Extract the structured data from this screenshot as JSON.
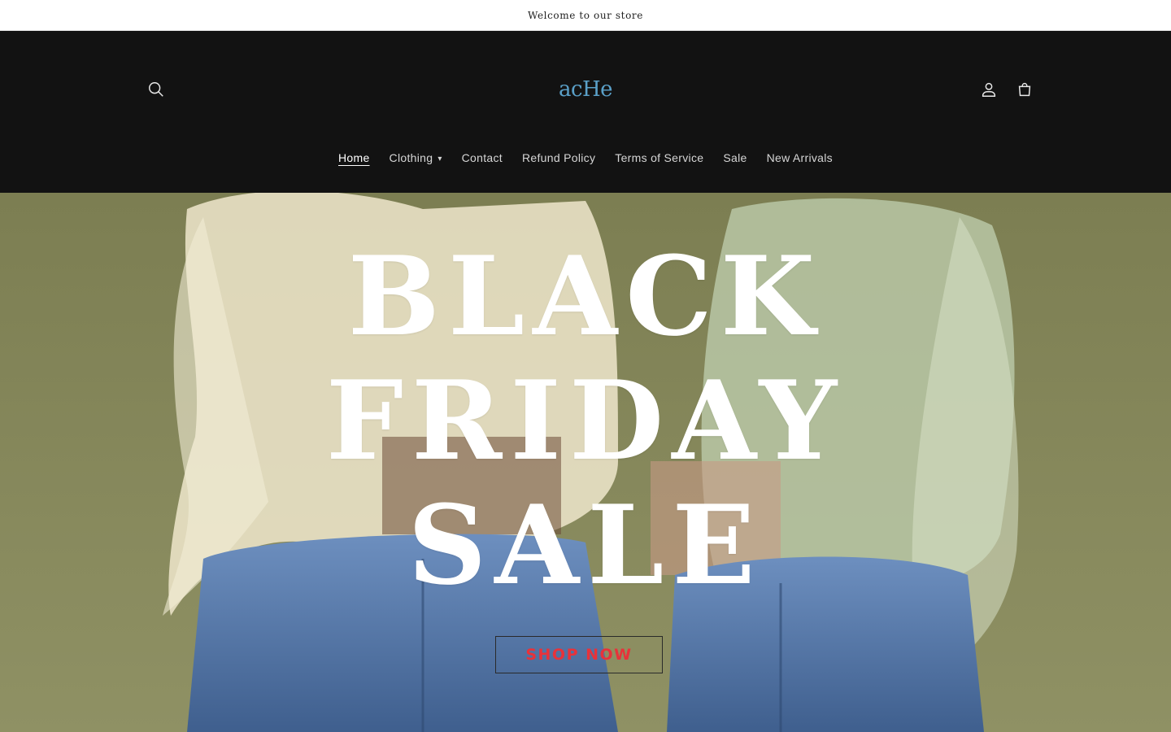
{
  "announcement": {
    "text": "Welcome to our store"
  },
  "header": {
    "logo_text": "acHe",
    "icons": {
      "search": "search-icon",
      "account": "account-icon",
      "cart": "cart-icon"
    }
  },
  "nav": {
    "items": [
      {
        "label": "Home",
        "active": true
      },
      {
        "label": "Clothing",
        "has_dropdown": true
      },
      {
        "label": "Contact"
      },
      {
        "label": "Refund Policy"
      },
      {
        "label": "Terms of Service"
      },
      {
        "label": "Sale"
      },
      {
        "label": "New Arrivals"
      }
    ]
  },
  "hero": {
    "title_lines": [
      "BLACK",
      "FRIDAY",
      "SALE"
    ],
    "cta_label": "SHOP NOW"
  },
  "colors": {
    "header_bg": "#121212",
    "logo": "#5aa0c8",
    "cta_text": "#e8323a",
    "hero_bg": "#8a8a5c"
  }
}
